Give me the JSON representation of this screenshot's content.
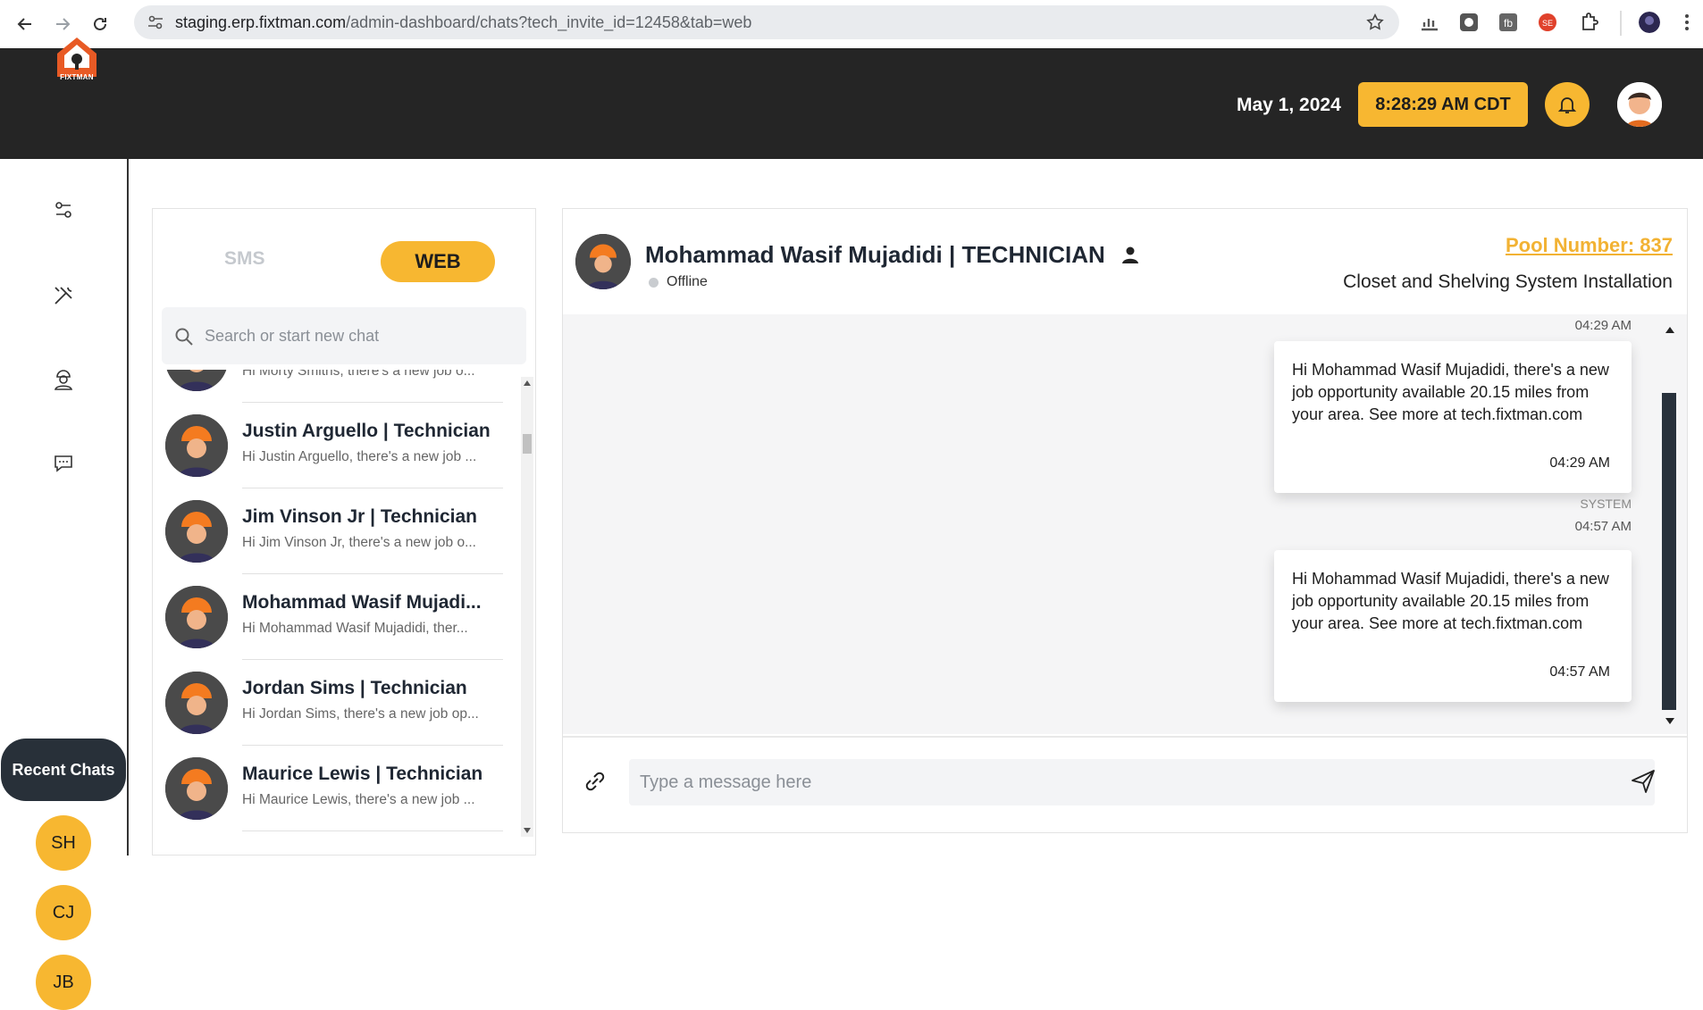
{
  "browser": {
    "url_host": "staging.erp.fixtman.com",
    "url_path": "/admin-dashboard/chats?tech_invite_id=12458&tab=web"
  },
  "header": {
    "logo_text": "FIXTMAN",
    "date": "May 1, 2024",
    "time": "8:28:29 AM CDT",
    "brand_color": "#f7b731",
    "bar_color": "#252525"
  },
  "rail": {
    "items": [
      {
        "icon": "filter-icon"
      },
      {
        "icon": "tools-icon"
      },
      {
        "icon": "technician-icon"
      },
      {
        "icon": "chat-icon"
      }
    ],
    "recent_label": "Recent Chats",
    "recent_chips": [
      "SH",
      "CJ",
      "JB"
    ]
  },
  "chat_list": {
    "tabs": {
      "sms": "SMS",
      "web": "WEB",
      "active": "WEB"
    },
    "search_placeholder": "Search or start new chat",
    "items": [
      {
        "name": "",
        "preview": "Hi Morty Smiths, there's a new job o..."
      },
      {
        "name": "Justin Arguello | Technician",
        "preview": "Hi Justin Arguello, there's a new job ..."
      },
      {
        "name": "Jim Vinson Jr | Technician",
        "preview": "Hi Jim Vinson Jr, there's a new job o..."
      },
      {
        "name": "Mohammad Wasif Mujadi...",
        "preview": "Hi Mohammad Wasif Mujadidi, ther..."
      },
      {
        "name": "Jordan Sims | Technician",
        "preview": "Hi Jordan Sims, there's a new job op..."
      },
      {
        "name": "Maurice Lewis | Technician",
        "preview": "Hi Maurice Lewis, there's a new job ..."
      }
    ]
  },
  "conversation": {
    "name": "Mohammad Wasif Mujadidi | TECHNICIAN",
    "status": "Offline",
    "pool_number": "Pool Number: 837",
    "job_title": "Closet and Shelving System Installation",
    "messages": [
      {
        "sender": "",
        "header_time": "04:29 AM",
        "text": "Hi Mohammad Wasif Mujadidi, there's a new job opportunity available 20.15 miles from your area. See more at tech.fixtman.com",
        "time": "04:29 AM"
      },
      {
        "sender": "SYSTEM",
        "header_time": "04:57 AM",
        "text": "Hi Mohammad Wasif Mujadidi, there's a new job opportunity available 20.15 miles from your area. See more at tech.fixtman.com",
        "time": "04:57 AM"
      }
    ],
    "composer_placeholder": "Type a message here"
  }
}
